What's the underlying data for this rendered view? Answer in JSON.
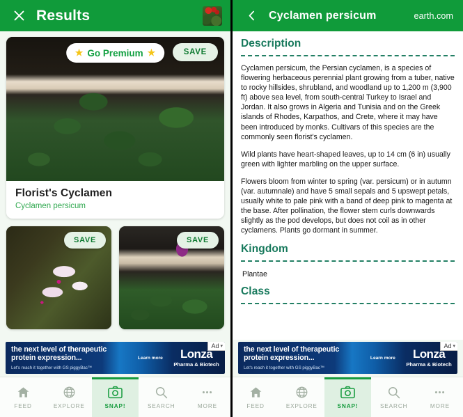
{
  "left": {
    "header": {
      "close_icon": "close-icon",
      "title": "Results",
      "thumbnail_alt": "captured-photo-thumbnail"
    },
    "results": [
      {
        "premium_label": "Go Premium",
        "star_glyph": "★",
        "save_label": "SAVE",
        "common_name": "Florist's Cyclamen",
        "scientific_name": "Cyclamen persicum",
        "image_alt": "cyclamen-leaves-photo"
      },
      {
        "save_label": "SAVE",
        "image_alt": "cyclamen-pale-pink-flower-photo"
      },
      {
        "save_label": "SAVE",
        "image_alt": "cyclamen-magenta-flower-potted-photo"
      }
    ]
  },
  "right": {
    "header": {
      "back_icon": "chevron-left-icon",
      "title": "Cyclamen persicum",
      "source": "earth.com"
    },
    "sections": [
      {
        "heading": "Description",
        "paragraphs": [
          "Cyclamen persicum, the Persian cyclamen, is a species of flowering herbaceous perennial plant growing from a tuber, native to rocky hillsides, shrubland, and woodland up to 1,200 m (3,900 ft) above sea level, from south-central Turkey to Israel and Jordan. It also grows in Algeria and Tunisia and on the Greek islands of Rhodes, Karpathos, and Crete, where it may have been introduced by monks. Cultivars of this species are the commonly seen florist's cyclamen.",
          "Wild plants have heart-shaped leaves, up to 14 cm (6 in) usually green with lighter marbling on the upper surface.",
          "Flowers bloom from winter to spring (var. persicum) or in autumn (var. autumnale) and have 5 small sepals and 5 upswept petals, usually white to pale pink with a band of deep pink to magenta at the base. After pollination, the flower stem curls downwards slightly as the pod develops, but does not coil as in other cyclamens. Plants go dormant in summer."
        ]
      },
      {
        "heading": "Kingdom",
        "value": "Plantae"
      },
      {
        "heading": "Class",
        "value": ""
      }
    ]
  },
  "ad": {
    "headline": "the next level of therapeutic protein expression...",
    "subline": "Let's reach it together with GS piggyBac™",
    "cta": "Learn more",
    "brand": "Lonza",
    "tagline": "Pharma & Biotech",
    "badge_label": "Ad",
    "badge_chevron": "▾"
  },
  "tabbar": {
    "items": [
      {
        "label": "FEED",
        "icon": "home-icon",
        "active": false
      },
      {
        "label": "EXPLORE",
        "icon": "globe-icon",
        "active": false
      },
      {
        "label": "SNAP!",
        "icon": "camera-icon",
        "active": true
      },
      {
        "label": "SEARCH",
        "icon": "search-icon",
        "active": false
      },
      {
        "label": "MORE",
        "icon": "ellipsis-icon",
        "active": false
      }
    ]
  },
  "colors": {
    "header_green": "#109b3a",
    "accent_green": "#159b3d",
    "section_teal": "#17795c",
    "scientific_green": "#2fa84f",
    "page_bg": "#f2f8f2",
    "star_yellow": "#f5c518"
  }
}
